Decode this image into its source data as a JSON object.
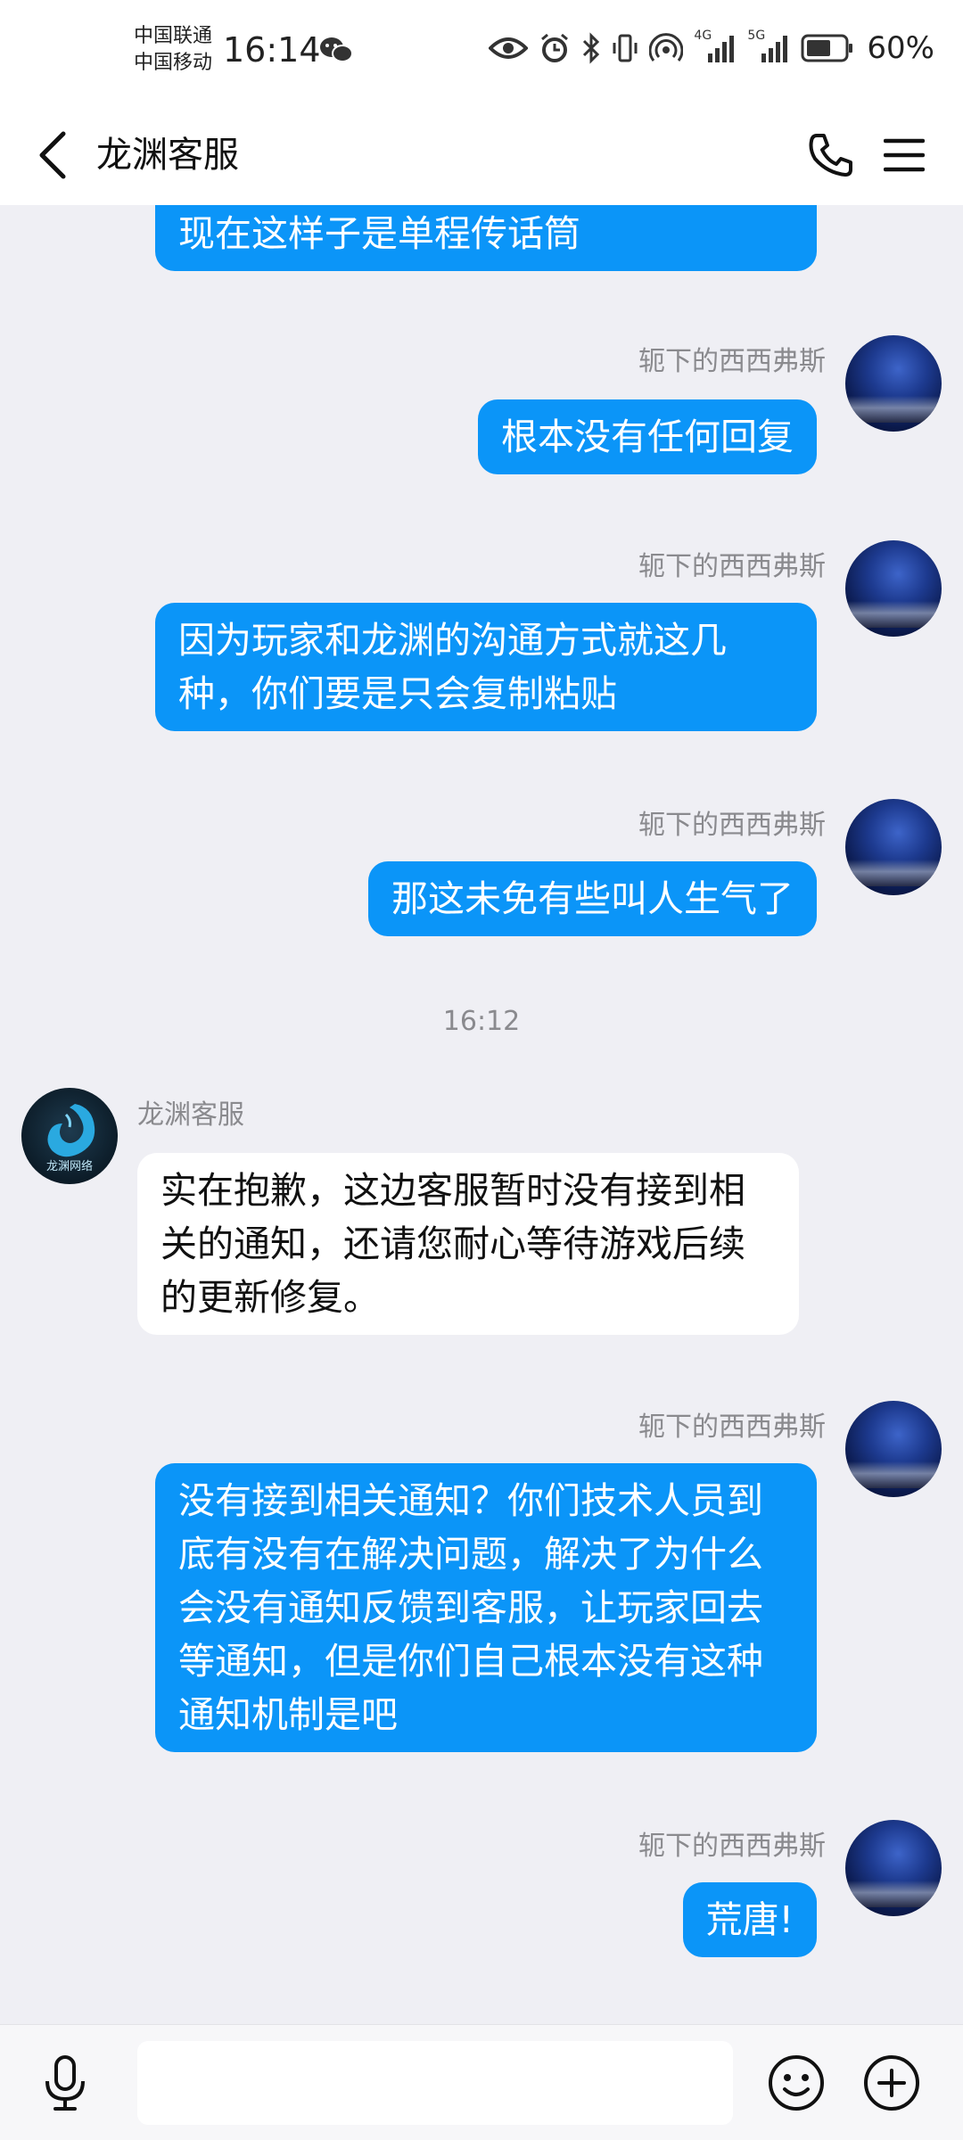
{
  "status_bar": {
    "carrier_1": "中国联通",
    "carrier_2": "中国移动",
    "time": "16:14",
    "battery": "60%",
    "net_1": "4G",
    "net_2": "5G"
  },
  "header": {
    "title": "龙渊客服"
  },
  "messages": [
    {
      "side": "out",
      "text": "现在这样子是单程传话筒"
    },
    {
      "side": "out",
      "sender": "轭下的西西弗斯",
      "text": "根本没有任何回复"
    },
    {
      "side": "out",
      "sender": "轭下的西西弗斯",
      "text": "因为玩家和龙渊的沟通方式就这几种，你们要是只会复制粘贴"
    },
    {
      "side": "out",
      "sender": "轭下的西西弗斯",
      "text": "那这未免有些叫人生气了"
    },
    {
      "type": "time",
      "text": "16:12"
    },
    {
      "side": "in",
      "sender": "龙渊客服",
      "text": "实在抱歉，这边客服暂时没有接到相关的通知，还请您耐心等待游戏后续的更新修复。",
      "avatar_text": "龙渊网络"
    },
    {
      "side": "out",
      "sender": "轭下的西西弗斯",
      "text": "没有接到相关通知？你们技术人员到底有没有在解决问题，解决了为什么会没有通知反馈到客服，让玩家回去等通知，但是你们自己根本没有这种通知机制是吧"
    },
    {
      "side": "out",
      "sender": "轭下的西西弗斯",
      "text": "荒唐!"
    }
  ],
  "input": {
    "placeholder": ""
  },
  "colors": {
    "outgoing_bubble": "#0b95f8",
    "background": "#efeff4"
  }
}
